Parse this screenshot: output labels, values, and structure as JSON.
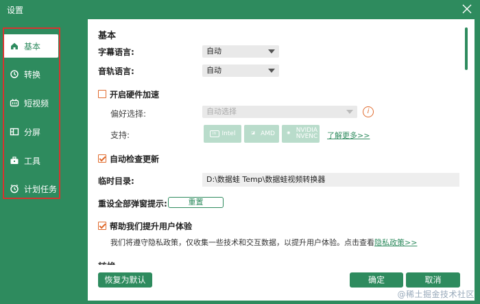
{
  "window": {
    "title": "设置"
  },
  "sidebar": {
    "items": [
      {
        "label": "基本",
        "icon": "home-icon"
      },
      {
        "label": "转换",
        "icon": "convert-icon"
      },
      {
        "label": "短视频",
        "icon": "short-video-icon"
      },
      {
        "label": "分屏",
        "icon": "split-screen-icon"
      },
      {
        "label": "工具",
        "icon": "toolbox-icon"
      },
      {
        "label": "计划任务",
        "icon": "clock-icon"
      }
    ]
  },
  "basic": {
    "heading": "基本",
    "subtitle_language": {
      "label": "字幕语言:",
      "value": "自动"
    },
    "audio_language": {
      "label": "音轨语言:",
      "value": "自动"
    },
    "hardware_accel": {
      "label": "开启硬件加速",
      "checked": false,
      "preference_label": "偏好选择:",
      "preference_value": "自动选择",
      "support_label": "支持:",
      "vendors": [
        "Intel",
        "AMD",
        "NVIDIA\nNVENC"
      ],
      "learn_more": "了解更多>>"
    },
    "auto_update": {
      "label": "自动检查更新",
      "checked": true
    },
    "temp_dir": {
      "label": "临时目录:",
      "value": "D:\\数据蛙 Temp\\数据蛙视频转换器"
    },
    "reset_popups": {
      "label": "重设全部弹窗提示:",
      "button": "重置"
    },
    "improve": {
      "label": "帮助我们提升用户体验",
      "checked": true,
      "note": "我们将遵守隐私政策，仅收集一些技术和交互数据，以提升用户体验。点击查看",
      "privacy_link": "隐私政策>>"
    },
    "next_heading": "转换"
  },
  "footer": {
    "restore_default": "恢复为默认",
    "ok": "确定",
    "cancel": "取消"
  },
  "watermark": "@稀土掘金技术社区",
  "colors": {
    "brand": "#2e8b5e",
    "accent": "#e06a2c",
    "highlight": "#d9332f"
  }
}
